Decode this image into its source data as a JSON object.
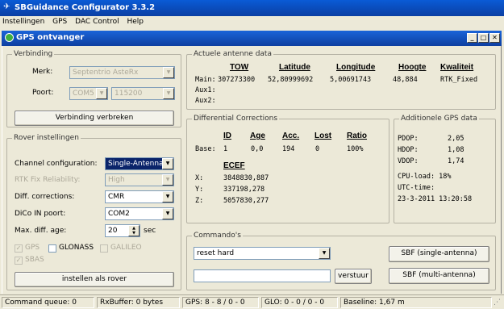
{
  "app": {
    "title": "SBGuidance Configurator 3.3.2"
  },
  "menu": [
    "Instellingen",
    "GPS",
    "DAC Control",
    "Help"
  ],
  "child_window": {
    "title": "GPS ontvanger"
  },
  "verbinding": {
    "legend": "Verbinding",
    "merk_label": "Merk:",
    "merk_value": "Septentrio AsteRx",
    "poort_label": "Poort:",
    "poort_value": "COM5",
    "baud_value": "115200",
    "disconnect_button": "Verbinding verbreken"
  },
  "rover": {
    "legend": "Rover instellingen",
    "channel_label": "Channel configuration:",
    "channel_value": "Single-Antenna",
    "rtk_label": "RTK Fix Reliability:",
    "rtk_value": "High",
    "diff_label": "Diff. corrections:",
    "diff_value": "CMR",
    "dico_label": "DiCo IN poort:",
    "dico_value": "COM2",
    "maxage_label": "Max. diff. age:",
    "maxage_value": "20",
    "maxage_unit": "sec",
    "gps_label": "GPS",
    "glonass_label": "GLONASS",
    "galileo_label": "GALILEO",
    "sbas_label": "SBAS",
    "apply_button": "instellen als rover"
  },
  "antenna": {
    "legend": "Actuele antenne data",
    "headers": [
      "TOW",
      "Latitude",
      "Longitude",
      "Hoogte",
      "Kwaliteit"
    ],
    "rows": [
      {
        "label": "Main:",
        "tow": "307273300",
        "lat": "52,80999692",
        "lon": "5,00691743",
        "h": "48,884",
        "q": "RTK_Fixed"
      },
      {
        "label": "Aux1:",
        "tow": "",
        "lat": "",
        "lon": "",
        "h": "",
        "q": ""
      },
      {
        "label": "Aux2:",
        "tow": "",
        "lat": "",
        "lon": "",
        "h": "",
        "q": ""
      }
    ]
  },
  "diffcorr": {
    "legend": "Differential Corrections",
    "headers": [
      "ID",
      "Age",
      "Acc.",
      "Lost",
      "Ratio"
    ],
    "base_label": "Base:",
    "base": [
      "1",
      "0,0",
      "194",
      "0",
      "100%"
    ],
    "ecef_header": "ECEF",
    "x_label": "X:",
    "x": "3848830,887",
    "y_label": "Y:",
    "y": "337198,278",
    "z_label": "Z:",
    "z": "5057830,277"
  },
  "extra": {
    "legend": "Additionele GPS data",
    "pdop_label": "PDOP:",
    "pdop": "2,05",
    "hdop_label": "HDOP:",
    "hdop": "1,08",
    "vdop_label": "VDOP:",
    "vdop": "1,74",
    "cpu": "CPU-load:  18%",
    "utc_label": "UTC-time:",
    "utc": "23-3-2011 13:20:58"
  },
  "commando": {
    "legend": "Commando's",
    "select_value": "reset hard",
    "input_value": "",
    "send_button": "verstuur",
    "sbf_single": "SBF (single-antenna)",
    "sbf_multi": "SBF (multi-antenna)"
  },
  "status": {
    "queue": "Command queue: 0",
    "rxbuf": "RxBuffer: 0 bytes",
    "gps": "GPS: 8 - 8 / 0 - 0",
    "glo": "GLO: 0 - 0 / 0 - 0",
    "baseline": "Baseline: 1,67 m"
  }
}
